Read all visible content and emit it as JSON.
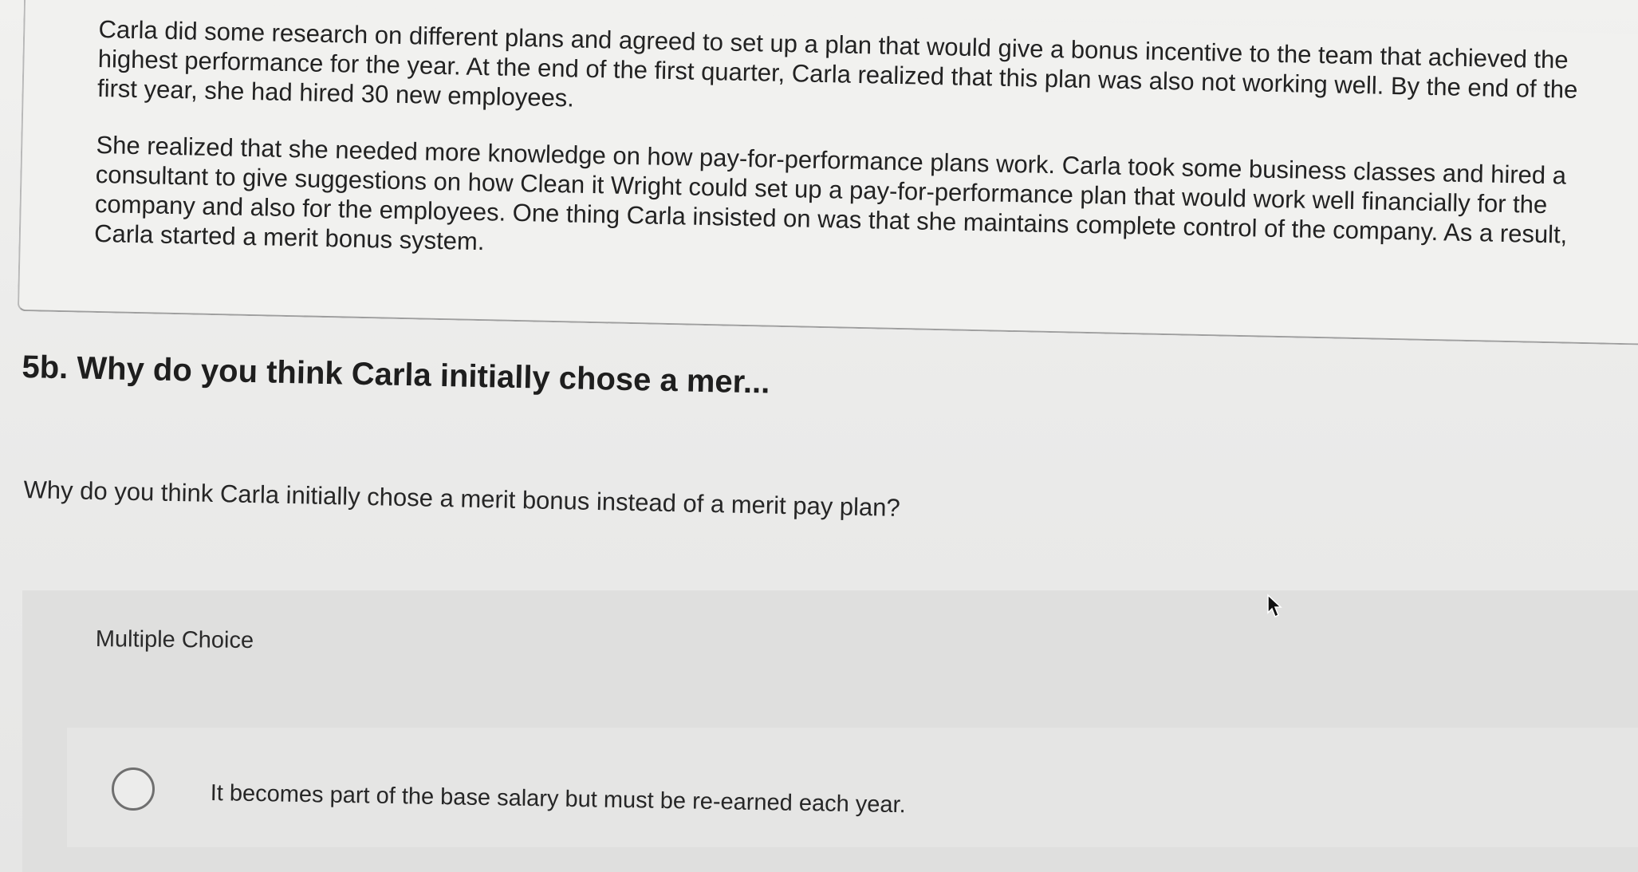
{
  "scenario": {
    "paragraph_1": "Carla did some research on different plans and agreed to set up a plan that would give a bonus incentive to the team that achieved the highest performance for the year. At the end of the first quarter, Carla realized that this plan was also not working well. By the end of the first year, she had hired 30 new employees.",
    "paragraph_2": "She realized that she needed more knowledge on how pay-for-performance plans work. Carla took some business classes and hired a consultant to give suggestions on how Clean it Wright could set up a pay-for-performance plan that would work well financially for the company and also for the employees. One thing Carla insisted on was that she maintains complete control of the company. As a result, Carla started a merit bonus system."
  },
  "question": {
    "heading": "5b. Why do you think Carla initially chose a mer...",
    "prompt": "Why do you think Carla initially chose a merit bonus instead of a merit pay plan?"
  },
  "multiple_choice": {
    "label": "Multiple Choice",
    "options": [
      {
        "text": "It becomes part of the base salary but must be re-earned each year.",
        "selected": false
      }
    ]
  },
  "icons": {
    "cursor": "mouse-pointer-icon",
    "radio": "radio-button-icon"
  }
}
